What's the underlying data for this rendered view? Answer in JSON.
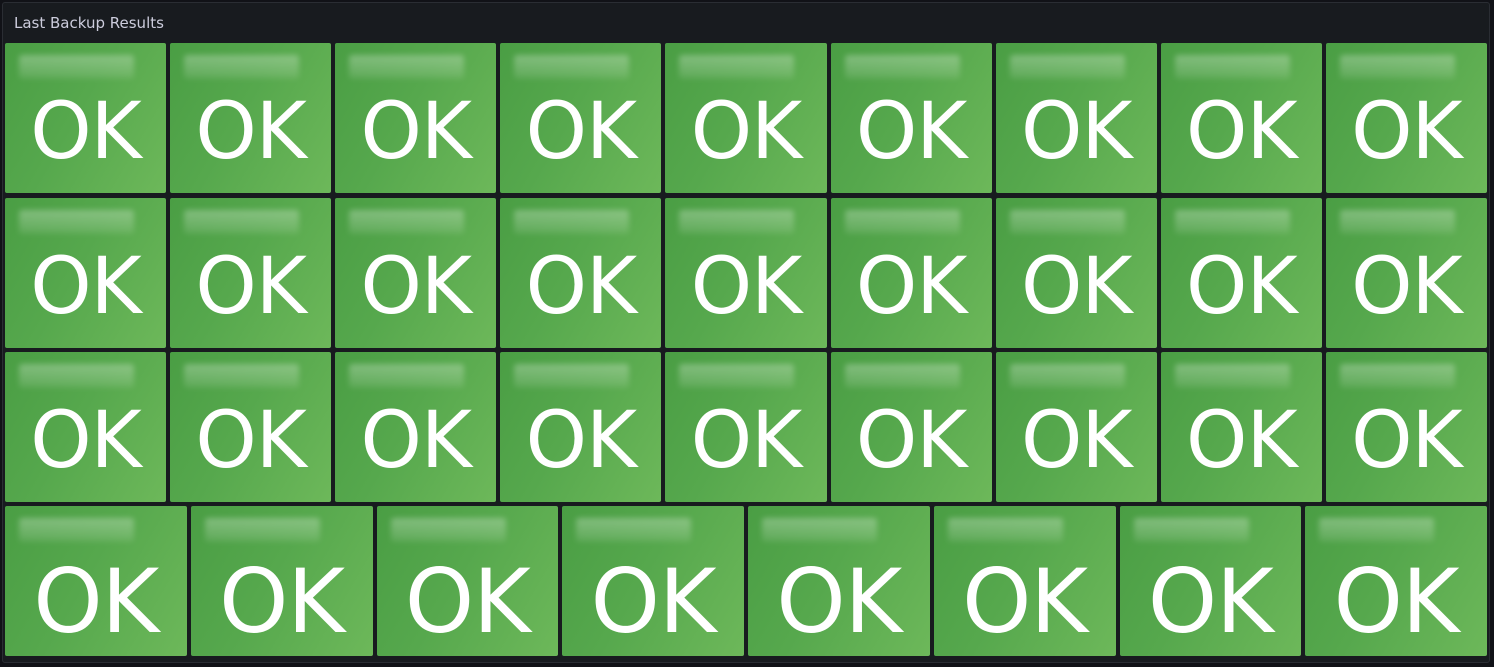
{
  "panel": {
    "title": "Last Backup Results"
  },
  "colors": {
    "background": "#111217",
    "panel": "#181b1f",
    "ok_green": "#56a84d",
    "text": "#ffffff"
  },
  "rows": [
    {
      "tiles": [
        {
          "name": "",
          "value": "OK"
        },
        {
          "name": "",
          "value": "OK"
        },
        {
          "name": "",
          "value": "OK"
        },
        {
          "name": "",
          "value": "OK"
        },
        {
          "name": "",
          "value": "OK"
        },
        {
          "name": "",
          "value": "OK"
        },
        {
          "name": "",
          "value": "OK"
        },
        {
          "name": "",
          "value": "OK"
        },
        {
          "name": "",
          "value": "OK"
        }
      ]
    },
    {
      "tiles": [
        {
          "name": "",
          "value": "OK"
        },
        {
          "name": "",
          "value": "OK"
        },
        {
          "name": "",
          "value": "OK"
        },
        {
          "name": "",
          "value": "OK"
        },
        {
          "name": "",
          "value": "OK"
        },
        {
          "name": "",
          "value": "OK"
        },
        {
          "name": "",
          "value": "OK"
        },
        {
          "name": "",
          "value": "OK"
        },
        {
          "name": "",
          "value": "OK"
        }
      ]
    },
    {
      "tiles": [
        {
          "name": "",
          "value": "OK"
        },
        {
          "name": "",
          "value": "OK"
        },
        {
          "name": "",
          "value": "OK"
        },
        {
          "name": "",
          "value": "OK"
        },
        {
          "name": "",
          "value": "OK"
        },
        {
          "name": "",
          "value": "OK"
        },
        {
          "name": "",
          "value": "OK"
        },
        {
          "name": "",
          "value": "OK"
        },
        {
          "name": "",
          "value": "OK"
        }
      ]
    },
    {
      "tiles": [
        {
          "name": "",
          "value": "OK"
        },
        {
          "name": "",
          "value": "OK"
        },
        {
          "name": "",
          "value": "OK"
        },
        {
          "name": "",
          "value": "OK"
        },
        {
          "name": "",
          "value": "OK"
        },
        {
          "name": "",
          "value": "OK"
        },
        {
          "name": "",
          "value": "OK"
        },
        {
          "name": "",
          "value": "OK"
        }
      ]
    }
  ]
}
